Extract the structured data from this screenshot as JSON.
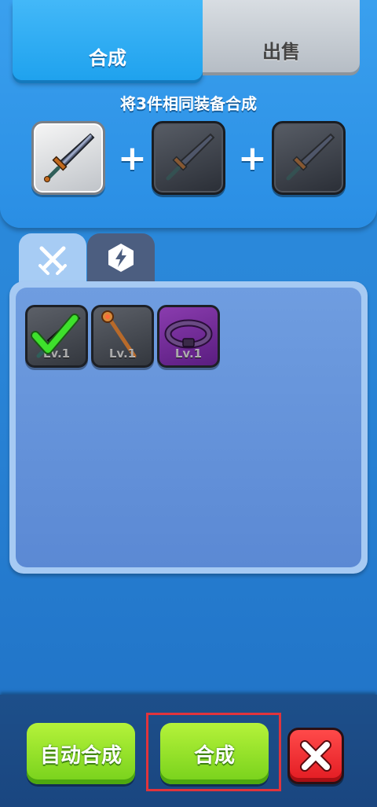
{
  "tabs": {
    "merge_label": "合成",
    "sell_label": "出售"
  },
  "hint_text": "将3件相同装备合成",
  "merge_slots": [
    {
      "item": "sword-icon",
      "filled": true
    },
    {
      "item": "sword-icon",
      "filled": false
    },
    {
      "item": "sword-icon",
      "filled": false
    }
  ],
  "plus_sign": "+",
  "category_tabs": [
    {
      "icon": "swords-icon",
      "active": true
    },
    {
      "icon": "lightning-hexagon-icon",
      "active": false
    }
  ],
  "inventory": [
    {
      "icon": "sword-icon",
      "level": "Lv.1",
      "selected": true,
      "rarity": "gray"
    },
    {
      "icon": "staff-icon",
      "level": "Lv.1",
      "selected": false,
      "rarity": "gray"
    },
    {
      "icon": "belt-icon",
      "level": "Lv.1",
      "selected": false,
      "rarity": "purple"
    }
  ],
  "buttons": {
    "auto_merge": "自动合成",
    "merge": "合成",
    "close_icon": "close-icon"
  },
  "colors": {
    "accent_blue": "#1fa2ee",
    "button_green": "#76d11b",
    "close_red": "#e21b22",
    "highlight_red": "#e0343c",
    "rare_purple": "#8a3cae"
  }
}
